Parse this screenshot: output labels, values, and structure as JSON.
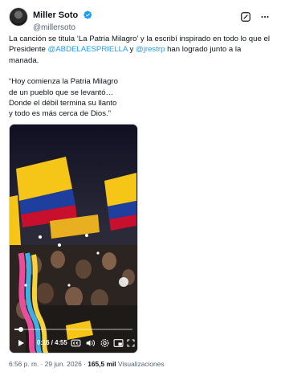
{
  "author": {
    "display_name": "Miller Soto",
    "handle": "@millersoto"
  },
  "tweet": {
    "line1_a": "La canción se titula ‘La Patria Milagro’ y la escribí inspirado en todo lo que el Presidente ",
    "mention1": "@ABDELAESPRIELLA",
    "line1_b": " y ",
    "mention2": "@jrestrp",
    "line1_c": " han logrado junto a la manada.",
    "quote_lines": [
      "“Hoy comienza la Patria Milagro",
      "de un pueblo que se levantó…",
      "Donde el débil termina su llanto",
      "y todo es más cerca de Dios.”"
    ]
  },
  "video": {
    "time_display": "0:16 / 4:55",
    "progress": 0.054
  },
  "meta": {
    "timestamp": "6:56 p. m. · 29 jun. 2026 · ",
    "views_count": "165,5 mil",
    "views_label": " Visualizaciones"
  },
  "colors": {
    "link": "#1d9bf0",
    "verified": "#1d9bf0",
    "secondary_text": "#536471"
  },
  "icons": [
    "verified-badge-icon",
    "grok-icon",
    "more-options-icon",
    "play-icon",
    "closed-captions-icon",
    "volume-icon",
    "settings-icon",
    "picture-in-picture-icon",
    "fullscreen-icon"
  ]
}
